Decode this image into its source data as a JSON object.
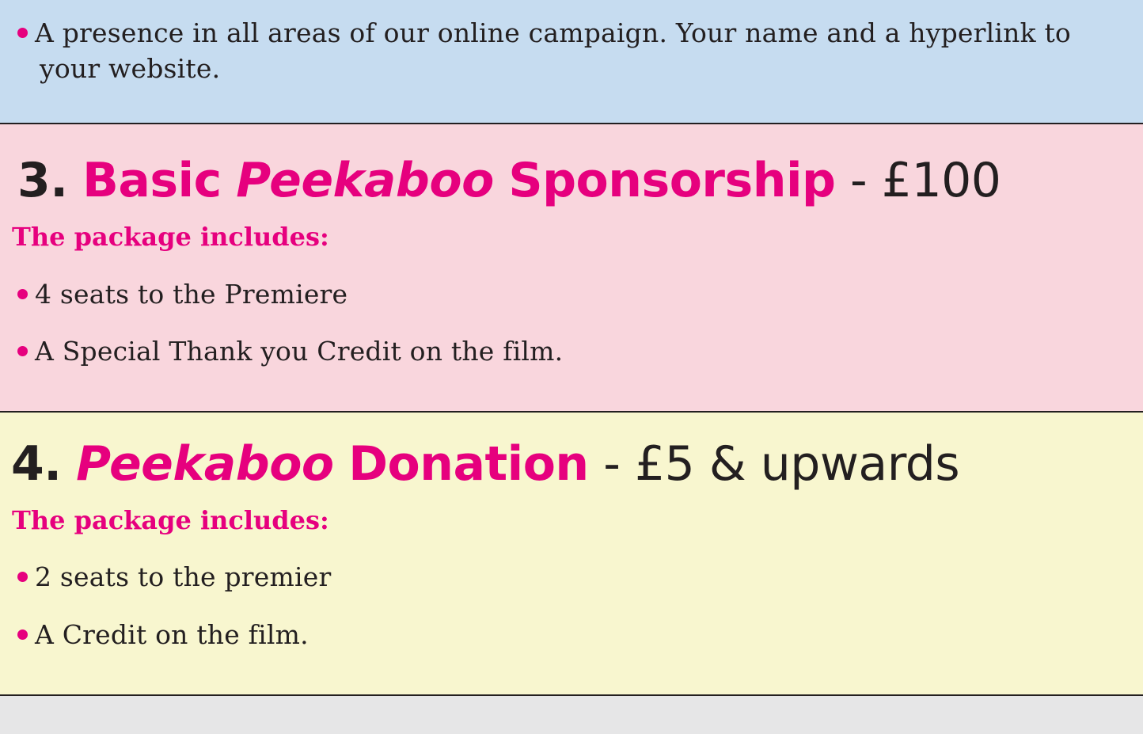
{
  "section_blue": {
    "bullet_line1": "A presence in all areas of our online campaign. Your name and a hyperlink to",
    "bullet_line2": "your website."
  },
  "section3": {
    "number": "3.",
    "title_pre": "Basic",
    "title_brand": "Peekaboo",
    "title_post": "Sponsorship",
    "price": "- £100",
    "subheading": "The package includes:",
    "items": [
      "4 seats to the Premiere",
      "A Special Thank you Credit on the film."
    ]
  },
  "section4": {
    "number": "4.",
    "title_brand": "Peekaboo",
    "title_post": "Donation",
    "price": "- £5 & upwards",
    "subheading": "The package includes:",
    "items": [
      "2 seats to the premier",
      "A Credit on the film."
    ]
  },
  "colors": {
    "accent_pink": "#e6007e",
    "text_dark": "#231f20",
    "bg_blue": "#c6dcf0",
    "bg_pink": "#f9d6dd",
    "bg_yellow": "#f8f6cf",
    "bg_grey": "#e6e6e7"
  }
}
